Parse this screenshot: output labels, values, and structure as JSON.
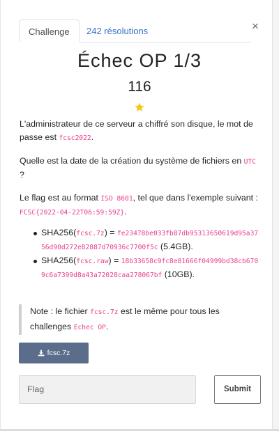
{
  "tabs": {
    "challenge_label": "Challenge",
    "solves_label": "242 résolutions",
    "close_glyph": "×"
  },
  "challenge": {
    "title": "Échec OP 1/3",
    "points": "116",
    "star_color": "#f5c518"
  },
  "description": {
    "p1_text": "L'administrateur de ce serveur a chiffré son disque, le mot de passe est ",
    "p1_code": "fcsc2022",
    "p1_end": ".",
    "p2_text": "Quelle est la date de la création du système de fichiers en ",
    "p2_code": "UTC",
    "p2_end": " ?",
    "p3_text": "Le flag est au format ",
    "p3_code1": "ISO 8601",
    "p3_text2": ", tel que dans l'exemple suivant : ",
    "p3_code2": "FCSC{2022-04-22T06:59:59Z}",
    "p3_end": ".",
    "hashes": [
      {
        "prefix": "SHA256(",
        "file": "fcsc.7z",
        "mid": ") = ",
        "hash": "fe23478be033fb87db95313650619d95a3756d90d272e82887d70936c7700f5c",
        "size": " (5.4GB)."
      },
      {
        "prefix": "SHA256(",
        "file": "fcsc.raw",
        "mid": ") = ",
        "hash": "18b33658c9fc8e81666f04999bd38cb6709c6a7399d8a43a72028caa278067bf",
        "size": " (10GB)."
      }
    ]
  },
  "note": {
    "text1": "Note : le fichier ",
    "code1": "fcsc.7z",
    "text2": " est le même pour tous les challenges ",
    "code2": "Echec OP",
    "end": "."
  },
  "download": {
    "label": "fcsc.7z",
    "icon": "download-icon"
  },
  "form": {
    "flag_placeholder": "Flag",
    "submit_label": "Submit"
  }
}
